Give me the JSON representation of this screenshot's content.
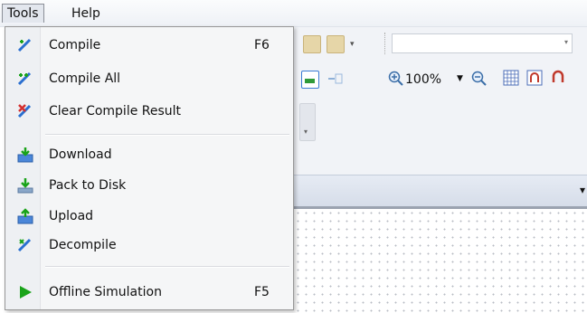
{
  "menubar": {
    "items": [
      {
        "label": "Tools"
      },
      {
        "label": "Help"
      }
    ]
  },
  "tools_menu": {
    "compile": {
      "label": "Compile",
      "shortcut": "F6",
      "icon": "compile-icon"
    },
    "compile_all": {
      "label": "Compile All",
      "icon": "compile-all-icon"
    },
    "clear_compile": {
      "label": "Clear Compile Result",
      "icon": "clear-compile-icon"
    },
    "download": {
      "label": "Download",
      "icon": "download-icon"
    },
    "pack_to_disk": {
      "label": "Pack to Disk",
      "icon": "pack-to-disk-icon"
    },
    "upload": {
      "label": "Upload",
      "icon": "upload-icon"
    },
    "decompile": {
      "label": "Decompile",
      "icon": "decompile-icon"
    },
    "offline_sim": {
      "label": "Offline Simulation",
      "shortcut": "F5",
      "icon": "play-icon"
    }
  },
  "toolbar": {
    "zoom": "100%"
  },
  "colors": {
    "menu_bg": "#f5f6f7",
    "accent_green": "#1aa31a",
    "accent_blue": "#2a6fd0"
  }
}
